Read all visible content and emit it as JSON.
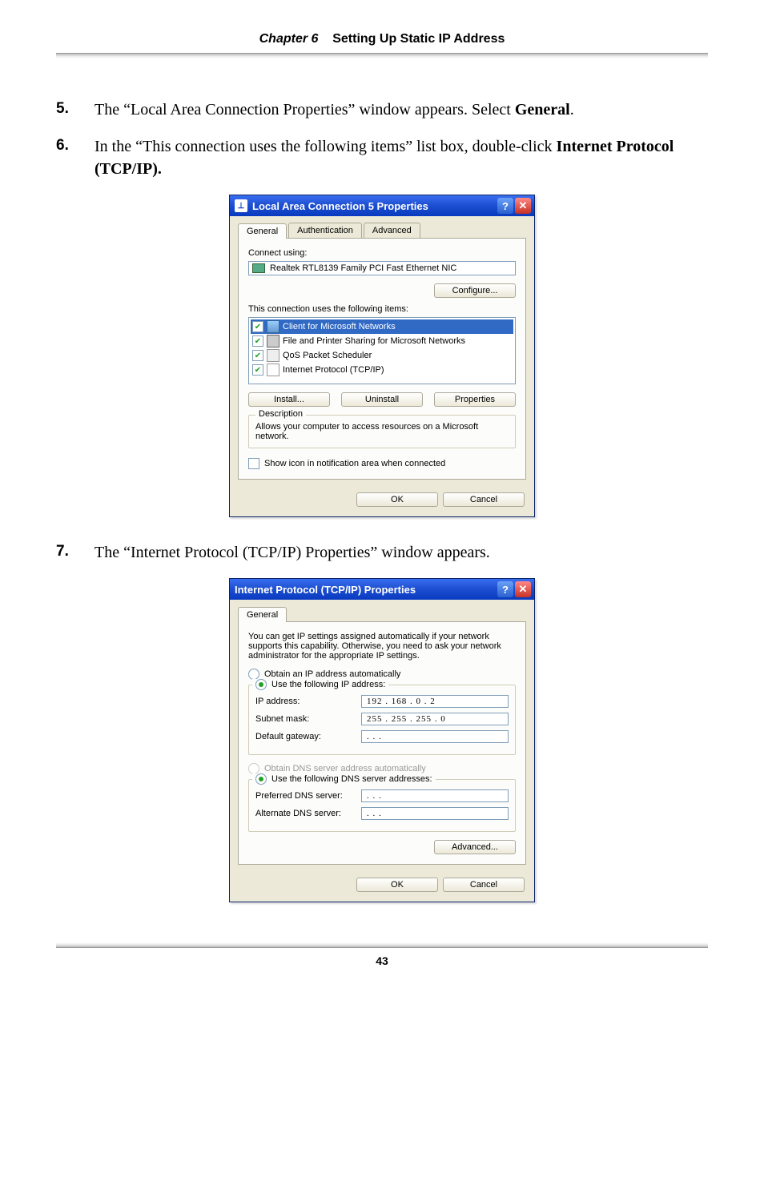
{
  "header": {
    "chapter": "Chapter 6",
    "title": "Setting Up Static IP Address"
  },
  "steps": {
    "s5": {
      "num": "5.",
      "pre": "The “Local Area Connection Properties” window appears. Select ",
      "bold": "General",
      "post": "."
    },
    "s6": {
      "num": "6.",
      "pre": "In the “This connection uses the following items” list box, double-click ",
      "bold": "Internet Protocol (",
      "sc": "TCP/IP",
      "post2": ")."
    },
    "s7": {
      "num": "7.",
      "pre": "The “Internet Protocol (",
      "sc": "TCP/IP",
      "post": ") Properties” window appears."
    }
  },
  "dlg1": {
    "title": "Local Area Connection 5 Properties",
    "tabs": {
      "general": "General",
      "auth": "Authentication",
      "adv": "Advanced"
    },
    "connect_using": "Connect using:",
    "adapter": "Realtek RTL8139 Family PCI Fast Ethernet NIC",
    "configure": "Configure...",
    "items_label": "This connection uses the following items:",
    "items": {
      "i0": "Client for Microsoft Networks",
      "i1": "File and Printer Sharing for Microsoft Networks",
      "i2": "QoS Packet Scheduler",
      "i3": "Internet Protocol (TCP/IP)"
    },
    "install": "Install...",
    "uninstall": "Uninstall",
    "properties": "Properties",
    "desc_legend": "Description",
    "desc_text": "Allows your computer to access resources on a Microsoft network.",
    "show_icon": "Show icon in notification area when connected",
    "ok": "OK",
    "cancel": "Cancel"
  },
  "dlg2": {
    "title": "Internet Protocol (TCP/IP) Properties",
    "tab_general": "General",
    "intro": "You can get IP settings assigned automatically if your network supports this capability. Otherwise, you need to ask your network administrator for the appropriate IP settings.",
    "r_obtain_ip": "Obtain an IP address automatically",
    "r_use_ip": "Use the following IP address:",
    "ip_label": "IP address:",
    "ip_value": "192 . 168 .  0  .  2",
    "subnet_label": "Subnet mask:",
    "subnet_value": "255 . 255 . 255 .  0",
    "gw_label": "Default gateway:",
    "gw_value": "  .     .     .   ",
    "r_obtain_dns": "Obtain DNS server address automatically",
    "r_use_dns": "Use the following DNS server addresses:",
    "pref_dns_label": "Preferred DNS server:",
    "pref_dns_value": "  .     .     .   ",
    "alt_dns_label": "Alternate DNS server:",
    "alt_dns_value": "  .     .     .   ",
    "advanced": "Advanced...",
    "ok": "OK",
    "cancel": "Cancel"
  },
  "page_number": "43"
}
